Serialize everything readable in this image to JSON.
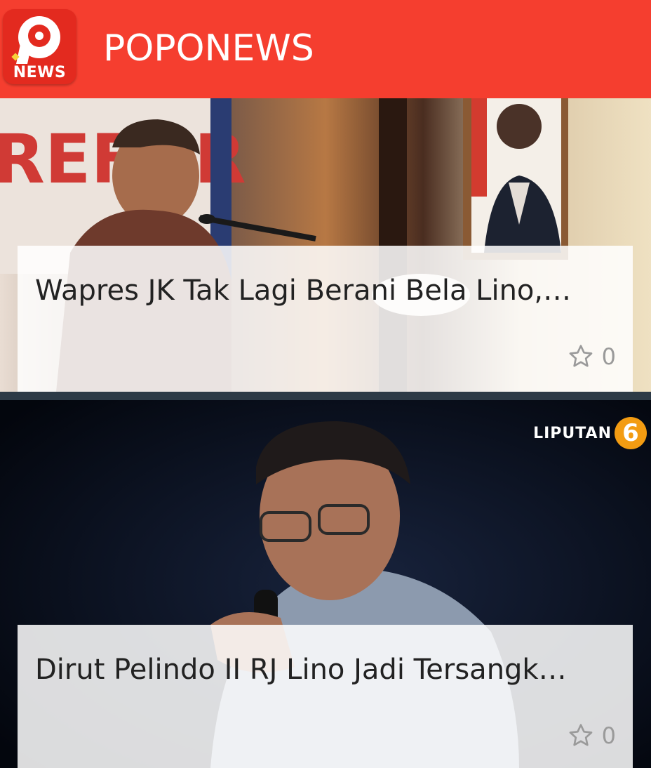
{
  "app": {
    "title": "POPONEWS",
    "logo_text": "NEWS",
    "accent_color": "#f53e2f"
  },
  "articles": [
    {
      "headline": "Wapres JK Tak Lagi Berani Bela Lino, Ini Alasannya",
      "headline_display": "Wapres JK Tak Lagi Berani Bela Lino,…",
      "likes": "0",
      "image_icon": "photo-jk-at-podium"
    },
    {
      "headline": "Dirut Pelindo II RJ Lino Jadi Tersangka, Ini Kata JK",
      "headline_display": "Dirut Pelindo II RJ Lino Jadi Tersangk…",
      "likes": "0",
      "image_icon": "photo-jk-with-microphone",
      "watermark": "LIPUTAN",
      "watermark_number": "6"
    }
  ]
}
